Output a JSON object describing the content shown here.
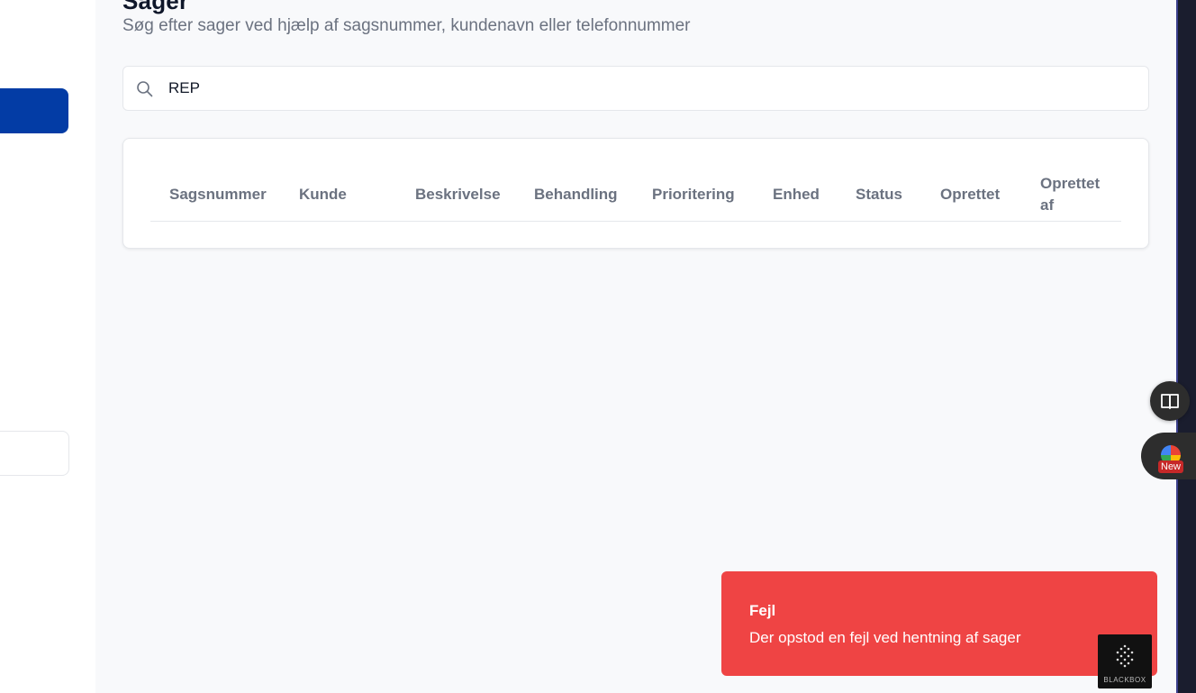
{
  "page": {
    "title": "Sager",
    "subtitle": "Søg efter sager ved hjælp af sagsnummer, kundenavn eller telefonnummer"
  },
  "search": {
    "value": "REP",
    "icon": "search-icon"
  },
  "table": {
    "columns": [
      "Sagsnummer",
      "Kunde",
      "Beskrivelse",
      "Behandling",
      "Prioritering",
      "Enhed",
      "Status",
      "Oprettet",
      "Oprettet af"
    ]
  },
  "toast": {
    "title": "Fejl",
    "message": "Der opstod en fejl ved hentning af sager"
  },
  "floating": {
    "new_badge": "New",
    "icons": [
      "book-open-icon",
      "globe-icon"
    ]
  },
  "blackbox": {
    "label": "BLACKBOX"
  },
  "colors": {
    "accent": "#033ca5",
    "error": "#ef4444",
    "background": "#f8f9fb"
  }
}
